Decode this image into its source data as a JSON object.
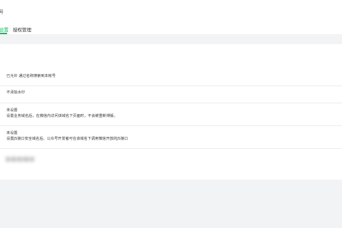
{
  "header": {
    "title": "号",
    "tabs": [
      {
        "label": "设置",
        "active": true
      },
      {
        "label": "授权管理",
        "active": false
      }
    ]
  },
  "settings": {
    "search": "已允许 通过名称搜索到本帐号",
    "watermark": "不添加水印",
    "business_domain": {
      "status": "未设置",
      "desc": "设置业务域名后，在微信内访问该域名下页面时，不会被重新排版。"
    },
    "js_domain": {
      "status": "未设置",
      "desc": "设置JS接口安全域名后，公众号开发者可在该域名下调用微信开放的JS接口"
    }
  },
  "colors": {
    "accent": "#07c160",
    "background": "#f2f3f5",
    "panel": "#ffffff"
  }
}
